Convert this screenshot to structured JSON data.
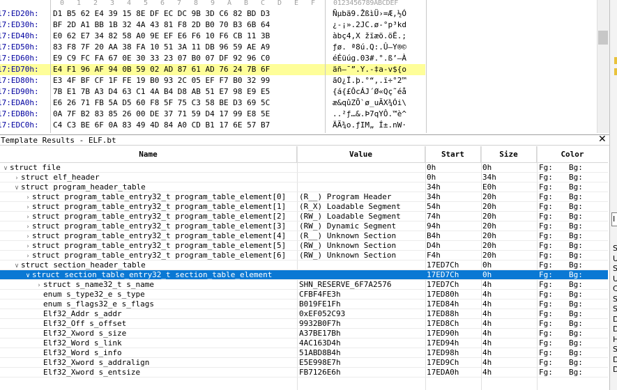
{
  "hex_view": {
    "ruler": {
      "columns": [
        "0",
        "1",
        "2",
        "3",
        "4",
        "5",
        "6",
        "7",
        "8",
        "9",
        "A",
        "B",
        "C",
        "D",
        "E",
        "F"
      ],
      "ascii": "0123456789ABCDEF"
    },
    "rows": [
      {
        "addr": "17:ED20h:",
        "bytes": "D1 B5 62 E4 39 15 8E DF EC DC 9B 3D C6 82 BD D3",
        "ascii": "Ñµbä9.ŽßìÜ›=Æ‚½Ó",
        "highlight": false
      },
      {
        "addr": "17:ED30h:",
        "bytes": "BF 2D A1 BB 1B 32 4A 43 81 F8 2D B0 70 B3 6B 64",
        "ascii": "¿-¡».2JC.ø-°p³kd",
        "highlight": false
      },
      {
        "addr": "17:ED40h:",
        "bytes": "E0 62 E7 34 82 58 A0 9E EF E6 F6 10 F6 CB 11 3B",
        "ascii": "àbç4‚X žïæö.öË.;",
        "highlight": false
      },
      {
        "addr": "17:ED50h:",
        "bytes": "83 F8 7F 20 AA 38 FA 10 51 3A 11 DB 96 59 AE A9",
        "ascii": "ƒø. ª8ú.Q:.Û–Y®©",
        "highlight": false
      },
      {
        "addr": "17:ED60h:",
        "bytes": "E9 C9 FC FA 67 0E 30 33 23 07 B0 07 DF 92 96 C0",
        "ascii": "éÉüúg.03#.°.ß’–À",
        "highlight": false
      },
      {
        "addr": "17:ED70h:",
        "bytes": "E4 F1 96 AF 94 0B 59 02 AD 87 61 AD 76 24 7B 6F",
        "ascii": "äñ–¯”.Y.-‡a-v${o",
        "highlight": true
      },
      {
        "addr": "17:ED80h:",
        "bytes": "E3 4F BF CF 1F FE 19 B0 93 2C 05 EF F7 B0 32 99",
        "ascii": "ãO¿Ï.þ.°“,.ï÷°2™",
        "highlight": false
      },
      {
        "addr": "17:ED90h:",
        "bytes": "7B E1 7B A3 D4 63 C1 4A B4 D8 AB 51 E7 98 E9 E5",
        "ascii": "{á{£ÔcÁJ´Ø«Qç˜éå",
        "highlight": false
      },
      {
        "addr": "17:EDA0h:",
        "bytes": "E6 26 71 FB 5A D5 60 F8 5F 75 C3 58 BE D3 69 5C",
        "ascii": "æ&qûZÕ`ø_uÃX¾Ói\\",
        "highlight": false
      },
      {
        "addr": "17:EDB0h:",
        "bytes": "0A 7F B2 83 85 26 00 DE 37 71 59 D4 17 99 E8 5E",
        "ascii": "..²ƒ…&.Þ7qYÔ.™è^",
        "highlight": false
      },
      {
        "addr": "17:EDC0h:",
        "bytes": "C4 C3 BE 6F 0A 83 49 4D 84 A0 CD B1 17 6E 57 B7",
        "ascii": "ÄÃ¾o.ƒIM„ Í±.nW·",
        "highlight": false
      }
    ]
  },
  "template_results": {
    "title": "Template Results - ELF.bt",
    "close_label": "✕",
    "columns": {
      "name": "Name",
      "value": "Value",
      "start": "Start",
      "size": "Size",
      "color": "Color"
    },
    "rows": [
      {
        "indent": 0,
        "toggle": "expanded",
        "name": "struct file",
        "value": "",
        "start": "0h",
        "size": "0h",
        "fg": "Fg:",
        "bg": "Bg:",
        "selected": false
      },
      {
        "indent": 1,
        "toggle": "collapsed",
        "name": "struct elf_header",
        "value": "",
        "start": "0h",
        "size": "34h",
        "fg": "Fg:",
        "bg": "Bg:",
        "selected": false
      },
      {
        "indent": 1,
        "toggle": "expanded",
        "name": "struct program_header_table",
        "value": "",
        "start": "34h",
        "size": "E0h",
        "fg": "Fg:",
        "bg": "Bg:",
        "selected": false
      },
      {
        "indent": 2,
        "toggle": "collapsed",
        "name": "struct program_table_entry32_t program_table_element[0]",
        "value": "(R__) Program Header",
        "start": "34h",
        "size": "20h",
        "fg": "Fg:",
        "bg": "Bg:",
        "selected": false
      },
      {
        "indent": 2,
        "toggle": "collapsed",
        "name": "struct program_table_entry32_t program_table_element[1]",
        "value": "(R_X) Loadable Segment",
        "start": "54h",
        "size": "20h",
        "fg": "Fg:",
        "bg": "Bg:",
        "selected": false
      },
      {
        "indent": 2,
        "toggle": "collapsed",
        "name": "struct program_table_entry32_t program_table_element[2]",
        "value": "(RW_) Loadable Segment",
        "start": "74h",
        "size": "20h",
        "fg": "Fg:",
        "bg": "Bg:",
        "selected": false
      },
      {
        "indent": 2,
        "toggle": "collapsed",
        "name": "struct program_table_entry32_t program_table_element[3]",
        "value": "(RW_) Dynamic Segment",
        "start": "94h",
        "size": "20h",
        "fg": "Fg:",
        "bg": "Bg:",
        "selected": false
      },
      {
        "indent": 2,
        "toggle": "collapsed",
        "name": "struct program_table_entry32_t program_table_element[4]",
        "value": "(R__) Unknown Section",
        "start": "B4h",
        "size": "20h",
        "fg": "Fg:",
        "bg": "Bg:",
        "selected": false
      },
      {
        "indent": 2,
        "toggle": "collapsed",
        "name": "struct program_table_entry32_t program_table_element[5]",
        "value": "(RW_) Unknown Section",
        "start": "D4h",
        "size": "20h",
        "fg": "Fg:",
        "bg": "Bg:",
        "selected": false
      },
      {
        "indent": 2,
        "toggle": "collapsed",
        "name": "struct program_table_entry32_t program_table_element[6]",
        "value": "(RW_) Unknown Section",
        "start": "F4h",
        "size": "20h",
        "fg": "Fg:",
        "bg": "Bg:",
        "selected": false
      },
      {
        "indent": 1,
        "toggle": "expanded",
        "name": "struct section_header_table",
        "value": "",
        "start": "17ED7Ch",
        "size": "0h",
        "fg": "Fg:",
        "bg": "Bg:",
        "selected": false
      },
      {
        "indent": 2,
        "toggle": "expanded",
        "name": "struct section_table_entry32_t section_table_element",
        "value": "",
        "start": "17ED7Ch",
        "size": "0h",
        "fg": "Fg:",
        "bg": "Bg:",
        "selected": true
      },
      {
        "indent": 3,
        "toggle": "collapsed",
        "name": "struct s_name32_t s_name",
        "value": "SHN_RESERVE_6F7A2576",
        "start": "17ED7Ch",
        "size": "4h",
        "fg": "Fg:",
        "bg": "Bg:",
        "selected": false
      },
      {
        "indent": 3,
        "toggle": "none",
        "name": "enum s_type32_e s_type",
        "value": "CFBF4FE3h",
        "start": "17ED80h",
        "size": "4h",
        "fg": "Fg:",
        "bg": "Bg:",
        "selected": false
      },
      {
        "indent": 3,
        "toggle": "none",
        "name": "enum s_flags32_e s_flags",
        "value": "B019FE1Fh",
        "start": "17ED84h",
        "size": "4h",
        "fg": "Fg:",
        "bg": "Bg:",
        "selected": false
      },
      {
        "indent": 3,
        "toggle": "none",
        "name": "Elf32_Addr s_addr",
        "value": "0xEF052C93",
        "start": "17ED88h",
        "size": "4h",
        "fg": "Fg:",
        "bg": "Bg:",
        "selected": false
      },
      {
        "indent": 3,
        "toggle": "none",
        "name": "Elf32_Off s_offset",
        "value": "9932B0F7h",
        "start": "17ED8Ch",
        "size": "4h",
        "fg": "Fg:",
        "bg": "Bg:",
        "selected": false
      },
      {
        "indent": 3,
        "toggle": "none",
        "name": "Elf32_Xword s_size",
        "value": "A37BE17Bh",
        "start": "17ED90h",
        "size": "4h",
        "fg": "Fg:",
        "bg": "Bg:",
        "selected": false
      },
      {
        "indent": 3,
        "toggle": "none",
        "name": "Elf32_Word s_link",
        "value": "4AC163D4h",
        "start": "17ED94h",
        "size": "4h",
        "fg": "Fg:",
        "bg": "Bg:",
        "selected": false
      },
      {
        "indent": 3,
        "toggle": "none",
        "name": "Elf32_Word s_info",
        "value": "51ABD8B4h",
        "start": "17ED98h",
        "size": "4h",
        "fg": "Fg:",
        "bg": "Bg:",
        "selected": false
      },
      {
        "indent": 3,
        "toggle": "none",
        "name": "Elf32_Xword s_addralign",
        "value": "E5E998E7h",
        "start": "17ED9Ch",
        "size": "4h",
        "fg": "Fg:",
        "bg": "Bg:",
        "selected": false
      },
      {
        "indent": 3,
        "toggle": "none",
        "name": "Elf32_Xword s_entsize",
        "value": "FB7126E6h",
        "start": "17EDA0h",
        "size": "4h",
        "fg": "Fg:",
        "bg": "Bg:",
        "selected": false
      }
    ]
  },
  "right_panel": {
    "box_label": "I",
    "letters": [
      "S",
      "U",
      "S",
      "U",
      "C",
      "S",
      "S",
      "D",
      "D",
      "H",
      "S",
      "D",
      "D"
    ]
  },
  "colors": {
    "selection": "#0a78d4",
    "highlight": "#fefe99",
    "address": "#0000a0"
  }
}
